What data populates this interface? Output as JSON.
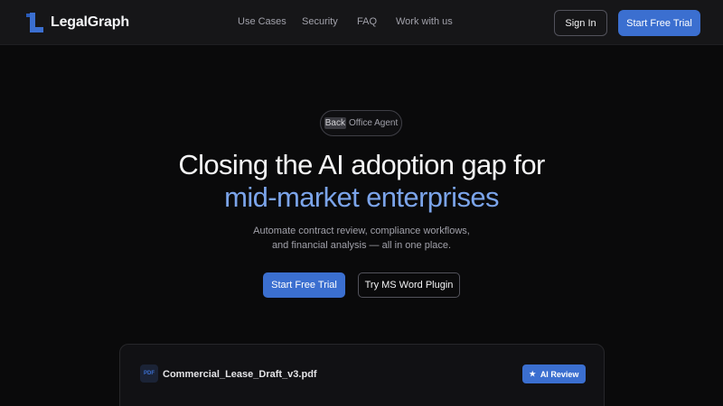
{
  "navbar": {
    "brand": "LegalGraph",
    "logo_icon": "legalgraph-logo",
    "links": [
      "Use Cases",
      "Security",
      "FAQ",
      "Work with us"
    ],
    "sign_in": "Sign In",
    "start_trial": "Start Free Trial"
  },
  "hero": {
    "badge_highlight": "Back",
    "badge_rest": "Office Agent",
    "headline_line1": "Closing the AI adoption gap for",
    "headline_line2": "mid-market enterprises",
    "sub_line1": "Automate contract review, compliance workflows,",
    "sub_line2": "and financial analysis — all in one place.",
    "cta_primary": "Start Free Trial",
    "cta_secondary": "Try MS Word Plugin"
  },
  "preview": {
    "file_icon_label": "PDF",
    "file_name": "Commercial_Lease_Draft_v3.pdf",
    "ai_review_icon": "star-icon",
    "ai_review_label": "AI Review"
  },
  "colors": {
    "background": "#0a0a0b",
    "navbar": "#161618",
    "accent": "#3b6fd0",
    "headline_accent": "#7ba4ea"
  }
}
